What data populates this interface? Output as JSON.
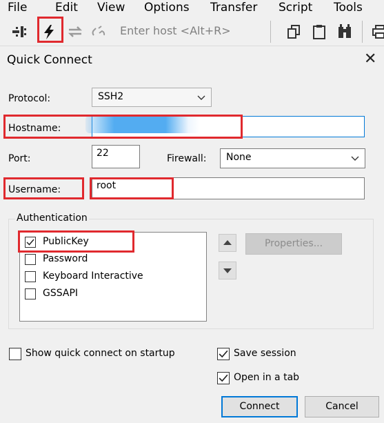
{
  "menubar": {
    "items": [
      "File",
      "Edit",
      "View",
      "Options",
      "Transfer",
      "Script",
      "Tools"
    ]
  },
  "toolbar": {
    "icons": [
      "connect-in-tab-icon",
      "quick-connect-icon",
      "reconnect-icon",
      "disconnect-icon",
      "copy-icon",
      "paste-icon",
      "find-icon",
      "print-icon"
    ],
    "host_placeholder": "Enter host <Alt+R>"
  },
  "dialog": {
    "title": "Quick Connect",
    "close_glyph": "✕",
    "protocol": {
      "label": "Protocol:",
      "value": "SSH2"
    },
    "hostname": {
      "label": "Hostname:",
      "value": ""
    },
    "port": {
      "label": "Port:",
      "value": "22"
    },
    "firewall": {
      "label": "Firewall:",
      "value": "None"
    },
    "username": {
      "label": "Username:",
      "value": "root"
    },
    "authentication": {
      "legend": "Authentication",
      "methods": [
        {
          "label": "PublicKey",
          "checked": true
        },
        {
          "label": "Password",
          "checked": false
        },
        {
          "label": "Keyboard Interactive",
          "checked": false
        },
        {
          "label": "GSSAPI",
          "checked": false
        }
      ],
      "properties_label": "Properties..."
    },
    "options": {
      "show_on_startup": {
        "label": "Show quick connect on startup",
        "checked": false
      },
      "save_session": {
        "label": "Save session",
        "checked": true
      },
      "open_in_tab": {
        "label": "Open in a tab",
        "checked": true
      }
    },
    "buttons": {
      "connect": "Connect",
      "cancel": "Cancel"
    }
  },
  "colors": {
    "highlight": "#e0292e",
    "focus": "#0078d7",
    "redaction": "#4aa8f0"
  }
}
